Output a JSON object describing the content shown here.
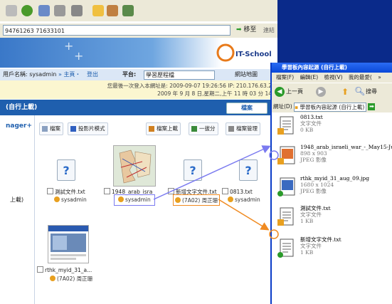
{
  "browser": {
    "address": "94761263 71633101",
    "go_label": "移至",
    "links_label": "連結"
  },
  "banner": {
    "logo_text": "IT-School"
  },
  "nav": {
    "user": "用戶名稱: sysadmin",
    "home": "» 主頁・",
    "logout": "登出",
    "platform_label": "平台:",
    "platform_value": "學習歷程檔",
    "site_map": "網站地圖"
  },
  "info": {
    "line1": "您最後一次登入本網址是: 2009-09-07 19:26:56 IP: 210.176.63.2",
    "line2": "2009 年 9 月 8 日,星期二,上午 11 時 03 分 14"
  },
  "header": {
    "title": "(自行上載)",
    "file_button": "檔案"
  },
  "sidebar": {
    "title": "nager+",
    "item": "上載)"
  },
  "actions": [
    {
      "label": "檔案",
      "color": "#8aa0c0"
    },
    {
      "label": "投影片模式",
      "color": "#3060c0"
    },
    {
      "label": "檔案上載",
      "color": "#d08020"
    },
    {
      "label": "一拔分",
      "color": "#3a8a3a"
    },
    {
      "label": "檔案管理",
      "color": "#888888"
    }
  ],
  "files": [
    {
      "name": "測試文件.txt",
      "owner": "sysadmin",
      "kind": "doc"
    },
    {
      "name": "1948_arab_isra",
      "owner": "sysadmin",
      "kind": "map"
    },
    {
      "name": "新增文字文件.txt",
      "owner": "(7A02) 周正珊",
      "kind": "doc"
    },
    {
      "name": "0813.txt",
      "owner": "sysadmin",
      "kind": "doc"
    },
    {
      "name": "rthk_myid_31_a...",
      "owner": "(7A02) 周正珊",
      "kind": "shot"
    }
  ],
  "explorer": {
    "title": "學習板內容起源 (自行上載)",
    "menu": [
      "檔案(F)",
      "編輯(E)",
      "檢視(V)",
      "我的最愛(",
      "»"
    ],
    "back": "上一頁",
    "search": "搜尋",
    "address_label": "網址(D)",
    "address": "學習板內容起源 (自行上載)",
    "files": [
      {
        "name": "0813.txt",
        "type": "文字文件",
        "size": "0 KB",
        "kind": "txt"
      },
      {
        "name": "1948_arab_israeli_war_-_May15-Ju...",
        "type": "JPEG 影像",
        "size": "898 x 903",
        "kind": "jpg"
      },
      {
        "name": "rthk_myid_31_aug_09.jpg",
        "type": "JPEG 影像",
        "size": "1680 x 1024",
        "kind": "jpg2"
      },
      {
        "name": "測試文件.txt",
        "type": "文字文件",
        "size": "1 KB",
        "kind": "txt"
      },
      {
        "name": "新增文字文件.txt",
        "type": "文字文件",
        "size": "1 KB",
        "kind": "txt"
      }
    ]
  },
  "colors": {
    "highlight_blue": "#7a7af0",
    "highlight_orange": "#f08a20"
  }
}
